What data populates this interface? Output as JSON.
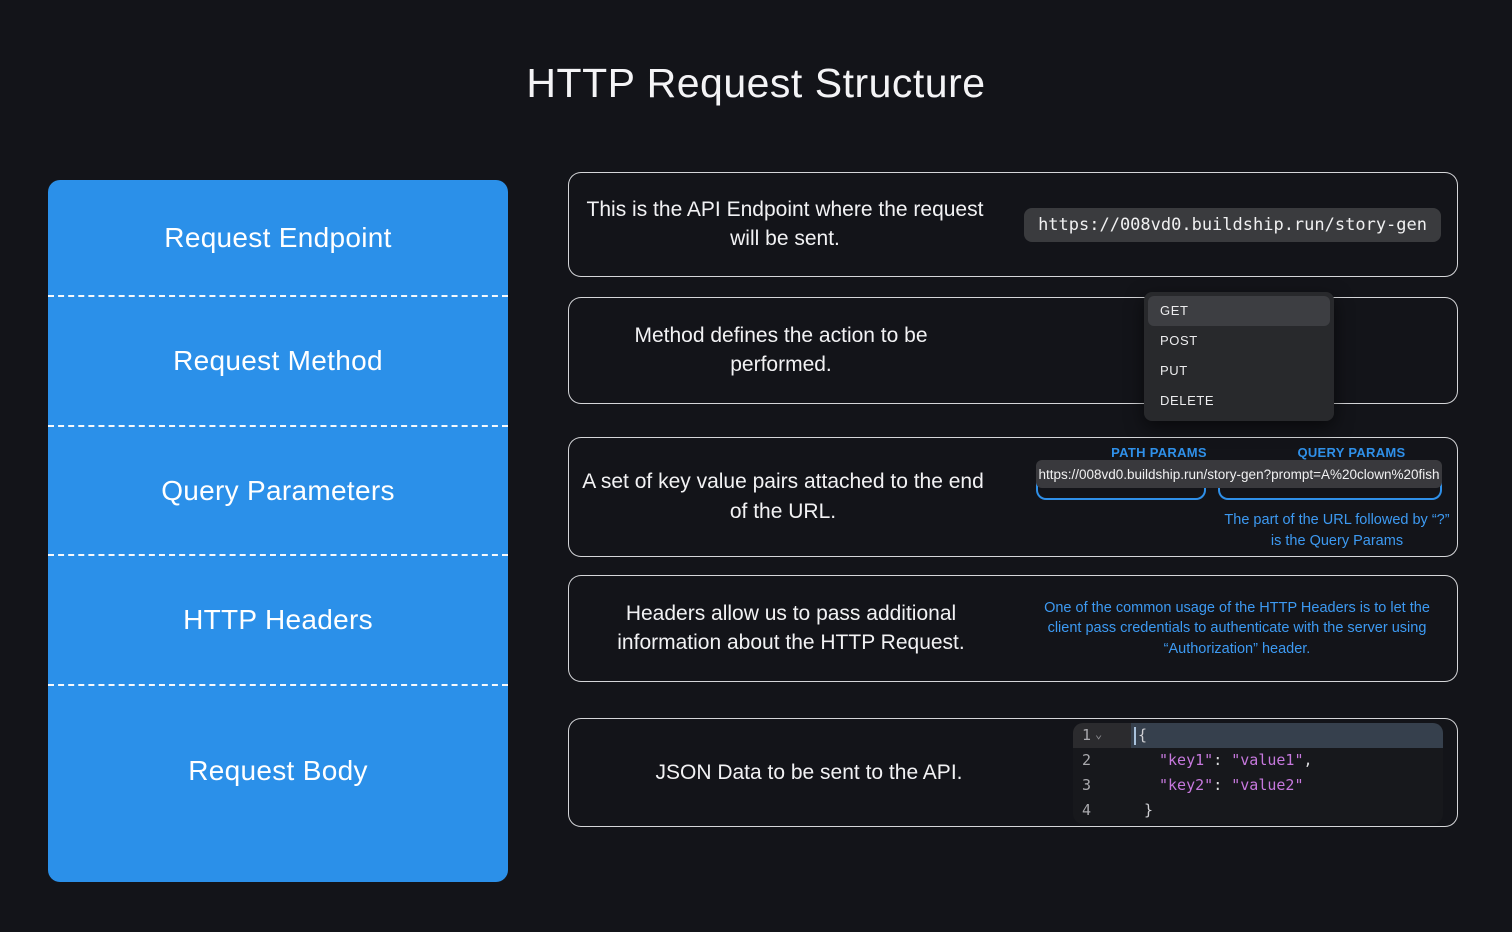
{
  "title": "HTTP Request Structure",
  "sidebar": {
    "items": [
      {
        "label": "Request Endpoint"
      },
      {
        "label": "Request Method"
      },
      {
        "label": "Query Parameters"
      },
      {
        "label": "HTTP Headers"
      },
      {
        "label": "Request Body"
      }
    ]
  },
  "panels": {
    "endpoint": {
      "description": "This is the API Endpoint where the request will be sent.",
      "url": "https://008vd0.buildship.run/story-gen"
    },
    "method": {
      "description": "Method defines the action to be performed.",
      "options": [
        "GET",
        "POST",
        "PUT",
        "DELETE"
      ],
      "selected": "GET"
    },
    "query": {
      "description": "A set of key value pairs attached to the end of the URL.",
      "path_label": "PATH PARAMS",
      "query_label": "QUERY PARAMS",
      "url": "https://008vd0.buildship.run/story-gen?prompt=A%20clown%20fish",
      "note": "The part of the URL followed by “?” is the Query Params"
    },
    "headers": {
      "description": "Headers allow us to pass additional information about the HTTP Request.",
      "note": "One of the common usage of the HTTP Headers is to let the client pass credentials to authenticate with the server using “Authorization” header."
    },
    "body": {
      "description": "JSON Data to be sent to the API.",
      "code": {
        "lines": [
          {
            "num": "1",
            "brace": "{"
          },
          {
            "num": "2",
            "key": "\"key1\"",
            "colon": ": ",
            "value": "\"value1\"",
            "comma": ","
          },
          {
            "num": "3",
            "key": "\"key2\"",
            "colon": ": ",
            "value": "\"value2\"",
            "comma": ""
          },
          {
            "num": "4",
            "brace": "}"
          }
        ]
      }
    }
  },
  "icons": {
    "chevron_down": "⌄"
  },
  "colors": {
    "accent_blue": "#2b90e9",
    "note_blue": "#3d9af2",
    "code_purple": "#c678dd",
    "background": "#131419",
    "chip_gray": "#3a3b3e"
  }
}
